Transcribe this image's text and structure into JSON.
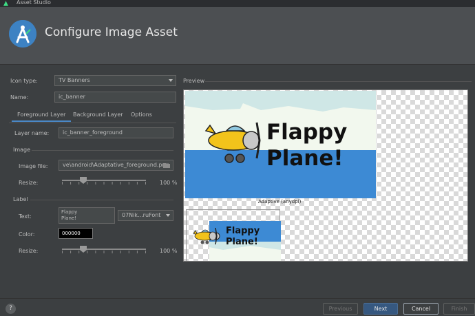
{
  "window": {
    "title": "Asset Studio"
  },
  "header": {
    "title": "Configure Image Asset"
  },
  "form": {
    "icon_type": {
      "label": "Icon type:",
      "value": "TV Banners"
    },
    "name": {
      "label": "Name:",
      "value": "ic_banner"
    }
  },
  "tabs": [
    {
      "label": "Foreground Layer",
      "active": true
    },
    {
      "label": "Background Layer",
      "active": false
    },
    {
      "label": "Options",
      "active": false
    }
  ],
  "foreground": {
    "layer_name": {
      "label": "Layer name:",
      "value": "ic_banner_foreground"
    },
    "image_section": "Image",
    "image_file": {
      "label": "Image file:",
      "value": "ve\\android\\Adaptative_foreground.png"
    },
    "image_resize": {
      "label": "Resize:",
      "value_text": "100 %",
      "level": 0.25
    },
    "label_section": "Label",
    "text": {
      "label": "Text:",
      "value_line1": "Flappy",
      "value_line2": "Plane!"
    },
    "font": {
      "value": "07Nik...ruFont"
    },
    "color": {
      "label": "Color:",
      "value": "000000"
    },
    "label_resize": {
      "label": "Resize:",
      "value_text": "100 %",
      "level": 0.25
    }
  },
  "preview": {
    "label": "Preview",
    "banner_text_line1": "Flappy",
    "banner_text_line2": "Plane!",
    "adaptive_caption": "Adaptive (anydpi)",
    "colors": {
      "sky": "#f2f8ee",
      "band": "#3d8ad4",
      "cloud": "#cfe7e6"
    }
  },
  "buttons": {
    "help": "?",
    "previous": "Previous",
    "next": "Next",
    "cancel": "Cancel",
    "finish": "Finish"
  }
}
